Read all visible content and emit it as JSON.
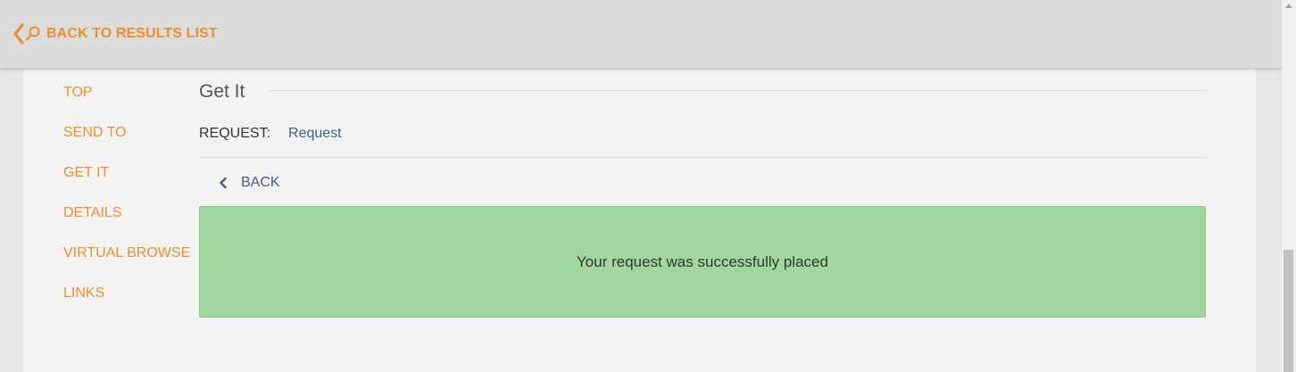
{
  "header": {
    "back_to_results_label": "BACK TO RESULTS LIST",
    "back_icon": "chevron-left-icon",
    "search_icon": "magnifier-icon"
  },
  "nav": {
    "items": [
      {
        "label": "TOP"
      },
      {
        "label": "SEND TO"
      },
      {
        "label": "GET IT"
      },
      {
        "label": "DETAILS"
      },
      {
        "label": "VIRTUAL BROWSE"
      },
      {
        "label": "LINKS"
      }
    ]
  },
  "get_it": {
    "title": "Get It",
    "request_label": "REQUEST:",
    "request_value": "Request",
    "back_label": "BACK",
    "success_message": "Your request was successfully placed"
  },
  "colors": {
    "accent_orange": "#ec8f2f",
    "link_blue": "#3f5f8a",
    "success_green": "#a1d69f",
    "header_bg": "#dcdcdc",
    "panel_bg": "#f3f3f3"
  }
}
